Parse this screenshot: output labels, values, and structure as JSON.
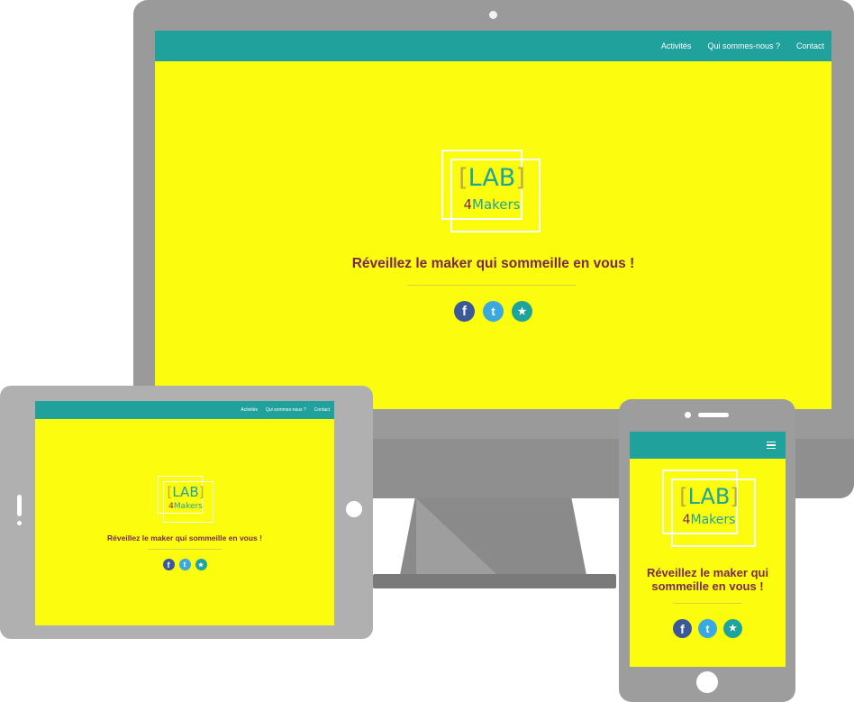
{
  "colors": {
    "screen_bg": "#fcfc0f",
    "navbar": "#21a19b",
    "tagline": "#7a2b4d",
    "logo_teal": "#1fa39d",
    "logo_bracket": "#b9a949"
  },
  "brand": {
    "logo_lab": "[LAB]",
    "logo_bracket_open": "[",
    "logo_lab_word": "LAB",
    "logo_bracket_close": "]",
    "logo_four": "4",
    "logo_makers": "Makers"
  },
  "nav": {
    "items": [
      "Activités",
      "Qui sommes-nous ?",
      "Contact"
    ]
  },
  "hero": {
    "tagline": "Réveillez le maker qui sommeille en vous !",
    "tagline_phone_line1": "Réveillez le maker qui",
    "tagline_phone_line2": "sommeille en vous !"
  },
  "social": [
    {
      "name": "facebook-icon",
      "glyph": "f"
    },
    {
      "name": "twitter-icon",
      "glyph": "t"
    },
    {
      "name": "shooting-star-icon",
      "glyph": "★"
    }
  ],
  "phone": {
    "menu_icon": "hamburger-menu-icon"
  }
}
